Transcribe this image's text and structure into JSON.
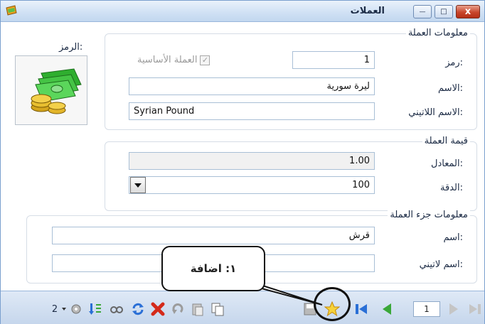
{
  "window": {
    "title": "العملات",
    "close_glyph": "x",
    "restore_glyph": "□",
    "minimize_glyph": "—"
  },
  "currency_info": {
    "legend": "معلومات العملة",
    "code_label": "رمز:",
    "code_value": "1",
    "base_currency_label": "العملة الأساسية",
    "base_currency_checked": true,
    "name_label": "الاسم:",
    "name_value": "ليرة سورية",
    "latin_name_label": "الاسم اللاتيني:",
    "latin_name_value": "Syrian Pound",
    "symbol_label": "الرمز:",
    "symbol_icon": "money-stack-coins-icon"
  },
  "currency_value": {
    "legend": "قيمة العملة",
    "equivalent_label": "المعادل:",
    "equivalent_value": "1.00",
    "precision_label": "الدقة:",
    "precision_value": "100"
  },
  "fraction_info": {
    "legend": "معلومات جزء العملة",
    "name_label": "اسم:",
    "name_value": "قرش",
    "latin_name_label": "اسم لاتيني:",
    "latin_name_value": ""
  },
  "toolbar": {
    "record_count": "2",
    "page_value": "1",
    "icons": [
      "settings-gear-icon",
      "sort-icon",
      "view-icon",
      "refresh-icon",
      "delete-icon",
      "undo-icon",
      "paste-icon",
      "copy-icon",
      "save-icon",
      "add-star-icon",
      "first-icon",
      "previous-icon",
      "next-icon",
      "last-icon"
    ]
  },
  "annotation": {
    "callout_text": "١: اضافة"
  },
  "colors": {
    "title_bar": "#cfe0f4",
    "close_button": "#c8452b",
    "toolbar": "#c5d6ec",
    "nav_green": "#3aa838"
  }
}
